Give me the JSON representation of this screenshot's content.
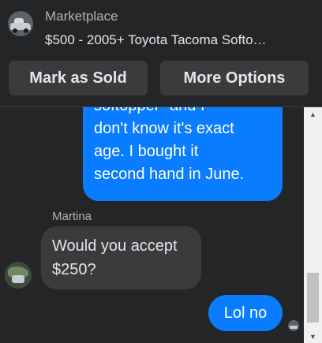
{
  "header": {
    "subtitle": "Marketplace",
    "listing_title": "$500 - 2005+ Toyota Tacoma Softo…",
    "avatar_icon": "truck-thumbnail",
    "buttons": {
      "mark_sold": "Mark as Sold",
      "more_options": "More Options"
    }
  },
  "messages": {
    "outgoing_1": {
      "lines": [
        "softopper\" and I",
        "don't know it's exact",
        "age. I bought it",
        "second hand in June."
      ]
    },
    "incoming_sender": "Martina",
    "incoming_1": "Would you accept $250?",
    "outgoing_2": "Lol no"
  },
  "colors": {
    "background": "#242526",
    "outgoing_bubble": "#0a7cff",
    "incoming_bubble": "#3a3b3c",
    "button_bg": "#3a3b3c"
  },
  "scrollbar": {
    "up_icon": "arrow-up-icon",
    "down_icon": "arrow-down-icon"
  }
}
